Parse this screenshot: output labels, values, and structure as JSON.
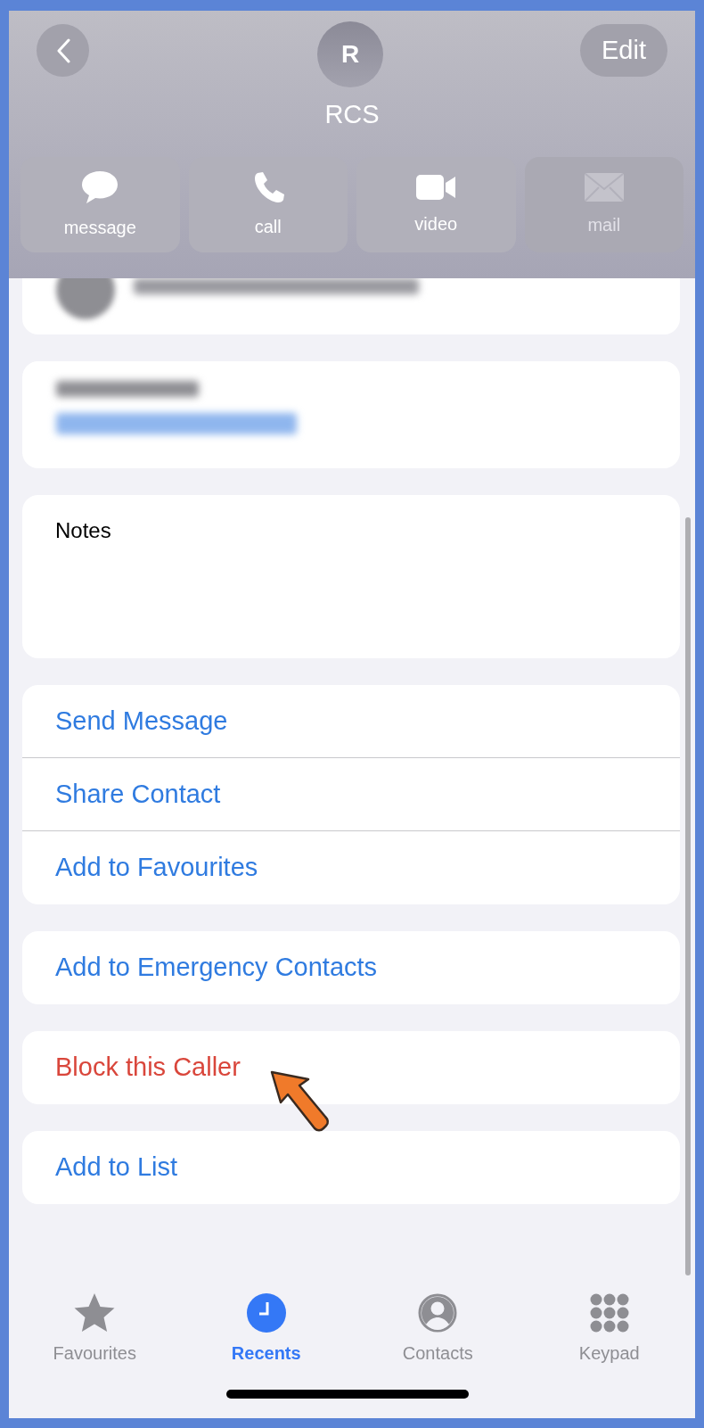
{
  "header": {
    "avatar_initial": "R",
    "name": "RCS",
    "edit_button": "Edit"
  },
  "actions": [
    {
      "label": "message",
      "kind": "message",
      "disabled": false
    },
    {
      "label": "call",
      "kind": "call",
      "disabled": false
    },
    {
      "label": "video",
      "kind": "video",
      "disabled": false
    },
    {
      "label": "mail",
      "kind": "mail",
      "disabled": true
    }
  ],
  "notes": {
    "label": "Notes"
  },
  "action_groups": [
    [
      {
        "label": "Send Message",
        "destructive": false
      },
      {
        "label": "Share Contact",
        "destructive": false
      },
      {
        "label": "Add to Favourites",
        "destructive": false
      }
    ],
    [
      {
        "label": "Add to Emergency Contacts",
        "destructive": false
      }
    ],
    [
      {
        "label": "Block this Caller",
        "destructive": true
      }
    ],
    [
      {
        "label": "Add to List",
        "destructive": false
      }
    ]
  ],
  "tabs": [
    {
      "label": "Favourites",
      "kind": "star",
      "selected": false
    },
    {
      "label": "Recents",
      "kind": "clock",
      "selected": true
    },
    {
      "label": "Contacts",
      "kind": "person",
      "selected": false
    },
    {
      "label": "Keypad",
      "kind": "keypad",
      "selected": false
    }
  ]
}
